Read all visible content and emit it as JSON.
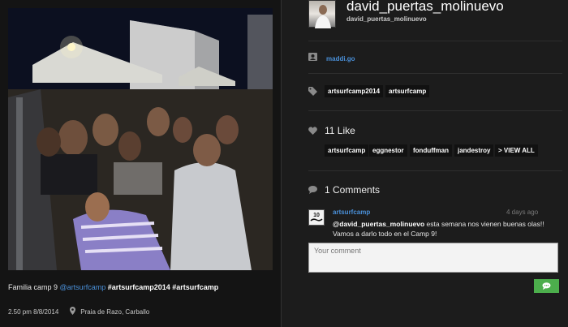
{
  "post": {
    "caption_title": "Familia camp 9",
    "caption_mention": "@artsurfcamp",
    "caption_hashtags": "#artsurfcamp2014 #artsurfcamp",
    "time": "2.50 pm 8/8/2014",
    "place": "Praia de Razo, Carballo"
  },
  "profile": {
    "username": "david_puertas_molinuevo",
    "handle": "david_puertas_molinuevo"
  },
  "location": {
    "name": "maddi.go",
    "icon": "user-location-icon"
  },
  "tags": {
    "icon": "tag-icon",
    "items": [
      "artsurfcamp2014",
      "artsurfcamp"
    ]
  },
  "likes": {
    "title": "11 Like",
    "icon": "heart-icon",
    "users": [
      "artsurfcamp",
      "eggnestor",
      "fonduffman",
      "jandestroy"
    ],
    "view_all": "> VIEW ALL"
  },
  "comments": {
    "title": "1 Comments",
    "icon": "comment-icon",
    "items": [
      {
        "author": "artsurfcamp",
        "time": "4 days ago",
        "mention": "@david_puertas_molinuevo",
        "text": " esta semana nos vienen buenas olas!! Vamos a darlo todo en el Camp 9!"
      }
    ],
    "placeholder": "Your comment",
    "send_icon": "chat-bubble-icon"
  },
  "colors": {
    "link": "#4a90d9",
    "send_button": "#4cae4c",
    "background": "#1c1c1c"
  }
}
